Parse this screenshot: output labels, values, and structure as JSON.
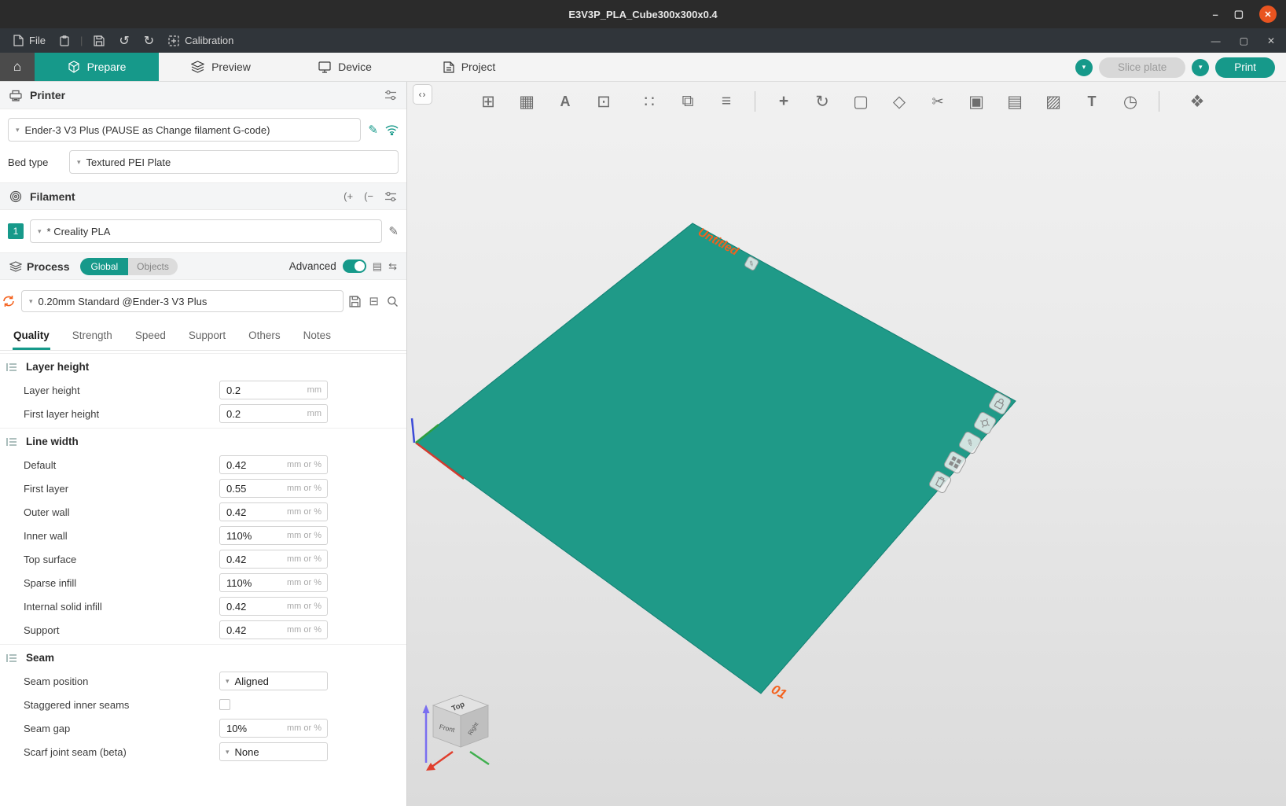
{
  "colors": {
    "accent": "#16998a",
    "plate": "#1f9a88",
    "orange": "#f4611c",
    "titlebar": "#2b2b2b",
    "menubar": "#30353a"
  },
  "window": {
    "title": "E3V3P_PLA_Cube300x300x0.4"
  },
  "icons": {
    "minimize": "–",
    "maximize": "▢",
    "close": "✕",
    "app_minimize": "—",
    "app_maximize": "▢",
    "app_close": "✕",
    "home": "⌂",
    "chevron": "▾",
    "collapse": "‹›",
    "undo": "↺",
    "redo": "↻",
    "edit": "✎",
    "add_filament": "(+",
    "remove_filament": "(−",
    "minus_box": "⊟",
    "preset_list": "▤",
    "preset_compare": "⇆"
  },
  "menubar": {
    "file": "File",
    "calibration": "Calibration"
  },
  "tabs": [
    {
      "label": "Prepare"
    },
    {
      "label": "Preview"
    },
    {
      "label": "Device"
    },
    {
      "label": "Project"
    }
  ],
  "actions": {
    "slice": "Slice plate",
    "print": "Print"
  },
  "printer": {
    "title": "Printer",
    "name": "Ender-3 V3 Plus (PAUSE as Change filament G-code)",
    "bed_label": "Bed type",
    "bed_value": "Textured PEI Plate"
  },
  "filament": {
    "title": "Filament",
    "index": "1",
    "name": "* Creality  PLA"
  },
  "process": {
    "title": "Process",
    "global": "Global",
    "objects": "Objects",
    "advanced": "Advanced",
    "profile": "0.20mm Standard @Ender-3 V3 Plus",
    "tabs": [
      "Quality",
      "Strength",
      "Speed",
      "Support",
      "Others",
      "Notes"
    ]
  },
  "settings": {
    "groups": [
      {
        "title": "Layer height",
        "rows": [
          {
            "label": "Layer height",
            "value": "0.2",
            "unit": "mm"
          },
          {
            "label": "First layer height",
            "value": "0.2",
            "unit": "mm"
          }
        ]
      },
      {
        "title": "Line width",
        "rows": [
          {
            "label": "Default",
            "value": "0.42",
            "unit": "mm or %"
          },
          {
            "label": "First layer",
            "value": "0.55",
            "unit": "mm or %"
          },
          {
            "label": "Outer wall",
            "value": "0.42",
            "unit": "mm or %"
          },
          {
            "label": "Inner wall",
            "value": "110%",
            "unit": "mm or %"
          },
          {
            "label": "Top surface",
            "value": "0.42",
            "unit": "mm or %"
          },
          {
            "label": "Sparse infill",
            "value": "110%",
            "unit": "mm or %"
          },
          {
            "label": "Internal solid infill",
            "value": "0.42",
            "unit": "mm or %"
          },
          {
            "label": "Support",
            "value": "0.42",
            "unit": "mm or %"
          }
        ]
      },
      {
        "title": "Seam",
        "rows": [
          {
            "label": "Seam position",
            "value": "Aligned",
            "type": "select"
          },
          {
            "label": "Staggered inner seams",
            "type": "checkbox",
            "checked": false
          },
          {
            "label": "Seam gap",
            "value": "10%",
            "unit": "mm or %"
          },
          {
            "label": "Scarf joint seam (beta)",
            "value": "None",
            "type": "select"
          }
        ]
      }
    ]
  },
  "viewport": {
    "object_label": "Untitled",
    "plate_number": "01",
    "navcube": {
      "top": "Top",
      "front": "Front",
      "right": "Right"
    },
    "toolbar": [
      {
        "name": "add-object",
        "glyph": "⊞"
      },
      {
        "name": "add-plate",
        "glyph": "▦"
      },
      {
        "name": "auto-orient",
        "glyph": "A"
      },
      {
        "name": "arrange",
        "glyph": "⊡"
      },
      {
        "name": "split-to-objects",
        "glyph": "∷"
      },
      {
        "name": "split-to-parts",
        "glyph": "⧉"
      },
      {
        "name": "object-list",
        "glyph": "≡"
      },
      {
        "name": "move",
        "glyph": "+"
      },
      {
        "name": "rotate",
        "glyph": "↻"
      },
      {
        "name": "scale",
        "glyph": "▢"
      },
      {
        "name": "lay-flat",
        "glyph": "◇"
      },
      {
        "name": "cut",
        "glyph": "✂"
      },
      {
        "name": "clone",
        "glyph": "▣"
      },
      {
        "name": "variable-layer-height",
        "glyph": "▤"
      },
      {
        "name": "seam-painting",
        "glyph": "▨"
      },
      {
        "name": "text-tool",
        "glyph": "T"
      },
      {
        "name": "measure",
        "glyph": "◷"
      },
      {
        "name": "assembly-view",
        "glyph": "❖"
      }
    ]
  }
}
